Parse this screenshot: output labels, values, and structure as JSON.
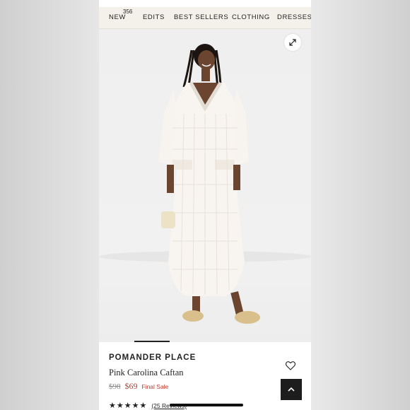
{
  "nav": {
    "items": [
      "NEW",
      "EDITS",
      "BEST SELLERS",
      "CLOTHING",
      "DRESSES"
    ],
    "badge": "356"
  },
  "product": {
    "brand": "POMANDER PLACE",
    "name": "Pink Carolina Caftan",
    "price_original": "$98",
    "price_sale": "$69",
    "sale_note": "Final Sale",
    "rating": 4.5,
    "stars": "★★★★★",
    "reviews": "(25 Reviews)"
  },
  "icons": {
    "expand": "expand-icon",
    "wishlist": "heart-icon",
    "back_to_top": "chevron-up-icon"
  },
  "colors": {
    "nav_bg": "#f4f1ea",
    "sale": "#c0392b",
    "button_dark": "#1d1d1d"
  }
}
